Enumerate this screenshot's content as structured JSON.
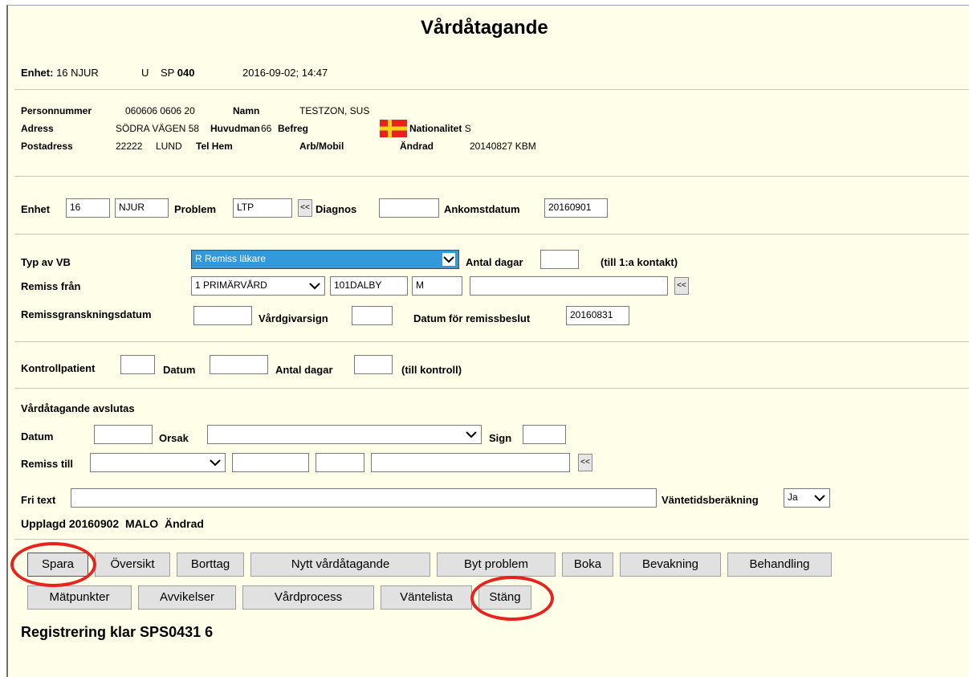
{
  "window": {
    "title": "Vårdåtagande"
  },
  "header": {
    "enhet_label": "Enhet:",
    "enhet_value": "16 NJUR",
    "u": "U",
    "sp_label": "SP",
    "sp_value": "040",
    "datetime": "2016-09-02; 14:47"
  },
  "person": {
    "personnummer_label": "Personnummer",
    "personnummer_value": "060606 0606  20",
    "namn_label": "Namn",
    "namn_value": "TESTZON, SUS",
    "adress_label": "Adress",
    "adress_value": "SÖDRA VÄGEN 58",
    "huvudman_label": "Huvudman",
    "huvudman_value": "66",
    "befreg_label": "Befreg",
    "nationalitet_label": "Nationalitet",
    "nationalitet_value": "S",
    "postadress_label": "Postadress",
    "postnr": "22222",
    "ort": "LUND",
    "telhem_label": "Tel Hem",
    "arbmobil_label": "Arb/Mobil",
    "andrad_label": "Ändrad",
    "andrad_value": "20140827  KBM"
  },
  "row1": {
    "enhet_label": "Enhet",
    "enhet_code": "16",
    "enhet_name": "NJUR",
    "problem_label": "Problem",
    "problem_value": "LTP",
    "lookup": "<<",
    "diagnos_label": "Diagnos",
    "diagnos_value": "",
    "ankomst_label": "Ankomstdatum",
    "ankomst_value": "20160901"
  },
  "remiss": {
    "typ_label": "Typ av VB",
    "typ_value": "R Remiss läkare",
    "antal_dagar_label": "Antal dagar",
    "antal_dagar_value": "",
    "till_kontakt": "(till 1:a kontakt)",
    "fran_label": "Remiss från",
    "fran_value": "1 PRIMÄRVÅRD",
    "fran_code": "101DALBY",
    "fran_m": "M",
    "fran_text": "",
    "lookup": "<<",
    "gransk_label": "Remissgranskningsdatum",
    "gransk_value": "",
    "vardgivar_label": "Vårdgivarsign",
    "vardgivar_value": "",
    "beslut_label": "Datum för remissbeslut",
    "beslut_value": "20160831"
  },
  "kontroll": {
    "patient_label": "Kontrollpatient",
    "datum_label": "Datum",
    "antal_label": "Antal dagar",
    "till": "(till kontroll)"
  },
  "avslut": {
    "heading": "Vårdåtagande avslutas",
    "datum_label": "Datum",
    "orsak_label": "Orsak",
    "sign_label": "Sign",
    "remiss_till_label": "Remiss till",
    "lookup": "<<",
    "fritext_label": "Fri text",
    "fritext_value": "",
    "vantetid_label": "Väntetidsberäkning",
    "vantetid_value": "Ja"
  },
  "footer": {
    "upplagd_label": "Upplagd",
    "upplagd_value": "20160902",
    "upplagd_sign": "MALO",
    "andrad_label": "Ändrad"
  },
  "buttons": {
    "spara": "Spara",
    "oversikt": "Översikt",
    "borttag": "Borttag",
    "nytt": "Nytt vårdåtagande",
    "byt_problem": "Byt problem",
    "boka": "Boka",
    "bevakning": "Bevakning",
    "behandling": "Behandling",
    "matpunkter": "Mätpunkter",
    "avvikelser": "Avvikelser",
    "vardprocess": "Vårdprocess",
    "vantelista": "Väntelista",
    "stang": "Stäng"
  },
  "status": {
    "message": "Registrering klar SPS0431 6"
  },
  "colors": {
    "background": "#ffffe9",
    "selection": "#3399dd",
    "annotation_ring": "#e8231e",
    "flag_field": "#e8231e",
    "flag_cross": "#f6d21c"
  }
}
